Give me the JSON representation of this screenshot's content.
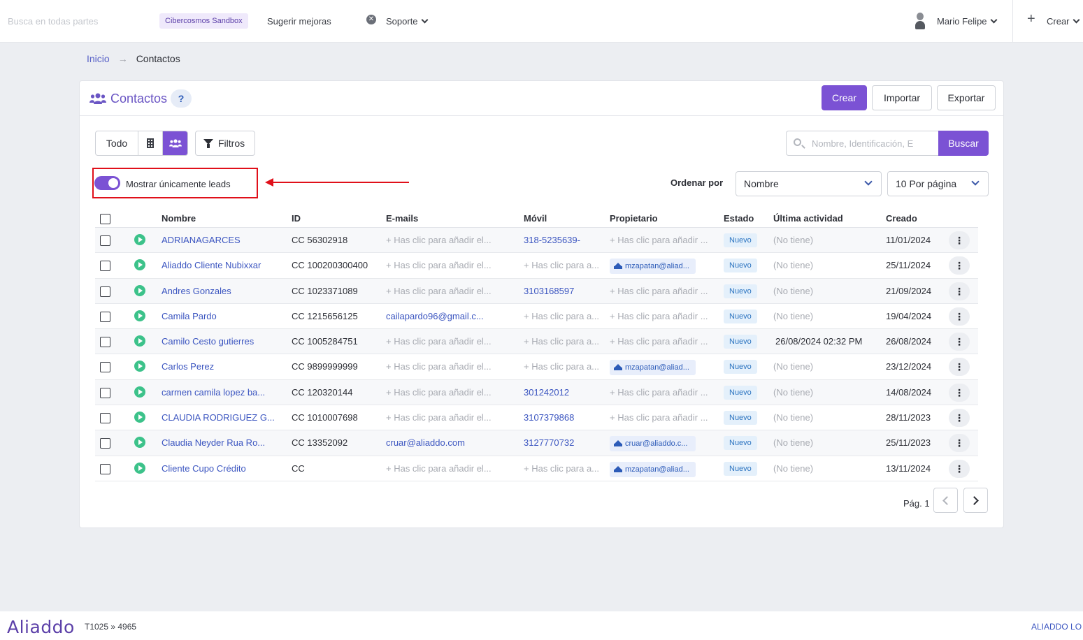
{
  "topbar": {
    "search_placeholder": "Busca en todas partes",
    "sandbox_badge": "Cibercosmos Sandbox",
    "suggest": "Sugerir mejoras",
    "support": "Soporte",
    "user": "Mario Felipe",
    "create": "Crear"
  },
  "breadcrumb": {
    "home": "Inicio",
    "arrow": "→",
    "current": "Contactos"
  },
  "card": {
    "title": "Contactos",
    "help": "?",
    "create": "Crear",
    "import": "Importar",
    "export": "Exportar"
  },
  "filters": {
    "all": "Todo",
    "filters_label": "Filtros",
    "search_placeholder": "Nombre, Identificación, E",
    "search_button": "Buscar",
    "leads_toggle_label": "Mostrar únicamente leads",
    "leads_toggle_on": true,
    "sort_label": "Ordenar por",
    "sort_value": "Nombre",
    "per_page_value": "10 Por página"
  },
  "table": {
    "headers": {
      "name": "Nombre",
      "id": "ID",
      "emails": "E-mails",
      "mobile": "Móvil",
      "owner": "Propietario",
      "status": "Estado",
      "last_activity": "Última actividad",
      "created": "Creado"
    },
    "rows": [
      {
        "name": "ADRIANAGARCES",
        "id": "CC 56302918",
        "email": "+ Has clic para añadir el...",
        "mobile": "318-5235639-",
        "owner": "+ Has clic para añadir ...",
        "status": "Nuevo",
        "last": "(No tiene)",
        "created": "11/01/2024"
      },
      {
        "name": "Aliaddo Cliente Nubixxar",
        "id": "CC 100200300400",
        "email": "+ Has clic para añadir el...",
        "mobile": "+ Has clic para a...",
        "owner": "mzapatan@aliad...",
        "status": "Nuevo",
        "last": "(No tiene)",
        "created": "25/11/2024"
      },
      {
        "name": "Andres Gonzales",
        "id": "CC 1023371089",
        "email": "+ Has clic para añadir el...",
        "mobile": "3103168597",
        "owner": "+ Has clic para añadir ...",
        "status": "Nuevo",
        "last": "(No tiene)",
        "created": "21/09/2024"
      },
      {
        "name": "Camila Pardo",
        "id": "CC 1215656125",
        "email": "cailapardo96@gmail.c...",
        "mobile": "+ Has clic para a...",
        "owner": "+ Has clic para añadir ...",
        "status": "Nuevo",
        "last": "(No tiene)",
        "created": "19/04/2024"
      },
      {
        "name": "Camilo Cesto gutierres",
        "id": "CC 1005284751",
        "email": "+ Has clic para añadir el...",
        "mobile": "+ Has clic para a...",
        "owner": "+ Has clic para añadir ...",
        "status": "Nuevo",
        "last": "26/08/2024 02:32 PM",
        "created": "26/08/2024"
      },
      {
        "name": "Carlos Perez",
        "id": "CC 9899999999",
        "email": "+ Has clic para añadir el...",
        "mobile": "+ Has clic para a...",
        "owner": "mzapatan@aliad...",
        "status": "Nuevo",
        "last": "(No tiene)",
        "created": "23/12/2024"
      },
      {
        "name": "carmen camila lopez ba...",
        "id": "CC 120320144",
        "email": "+ Has clic para añadir el...",
        "mobile": "301242012",
        "owner": "+ Has clic para añadir ...",
        "status": "Nuevo",
        "last": "(No tiene)",
        "created": "14/08/2024"
      },
      {
        "name": "CLAUDIA RODRIGUEZ G...",
        "id": "CC 1010007698",
        "email": "+ Has clic para añadir el...",
        "mobile": "3107379868",
        "owner": "+ Has clic para añadir ...",
        "status": "Nuevo",
        "last": "(No tiene)",
        "created": "28/11/2023"
      },
      {
        "name": "Claudia Neyder Rua Ro...",
        "id": "CC 13352092",
        "email": "cruar@aliaddo.com",
        "mobile": "3127770732",
        "owner": "cruar@aliaddo.c...",
        "status": "Nuevo",
        "last": "(No tiene)",
        "created": "25/11/2023"
      },
      {
        "name": "Cliente Cupo Crédito",
        "id": "CC",
        "email": "+ Has clic para añadir el...",
        "mobile": "+ Has clic para a...",
        "owner": "mzapatan@aliad...",
        "status": "Nuevo",
        "last": "(No tiene)",
        "created": "13/11/2024"
      }
    ]
  },
  "pagination": {
    "label": "Pág. 1"
  },
  "footer": {
    "logo": "Aliaddo",
    "version": "T1025 » 4965",
    "right": "ALIADDO LO"
  }
}
